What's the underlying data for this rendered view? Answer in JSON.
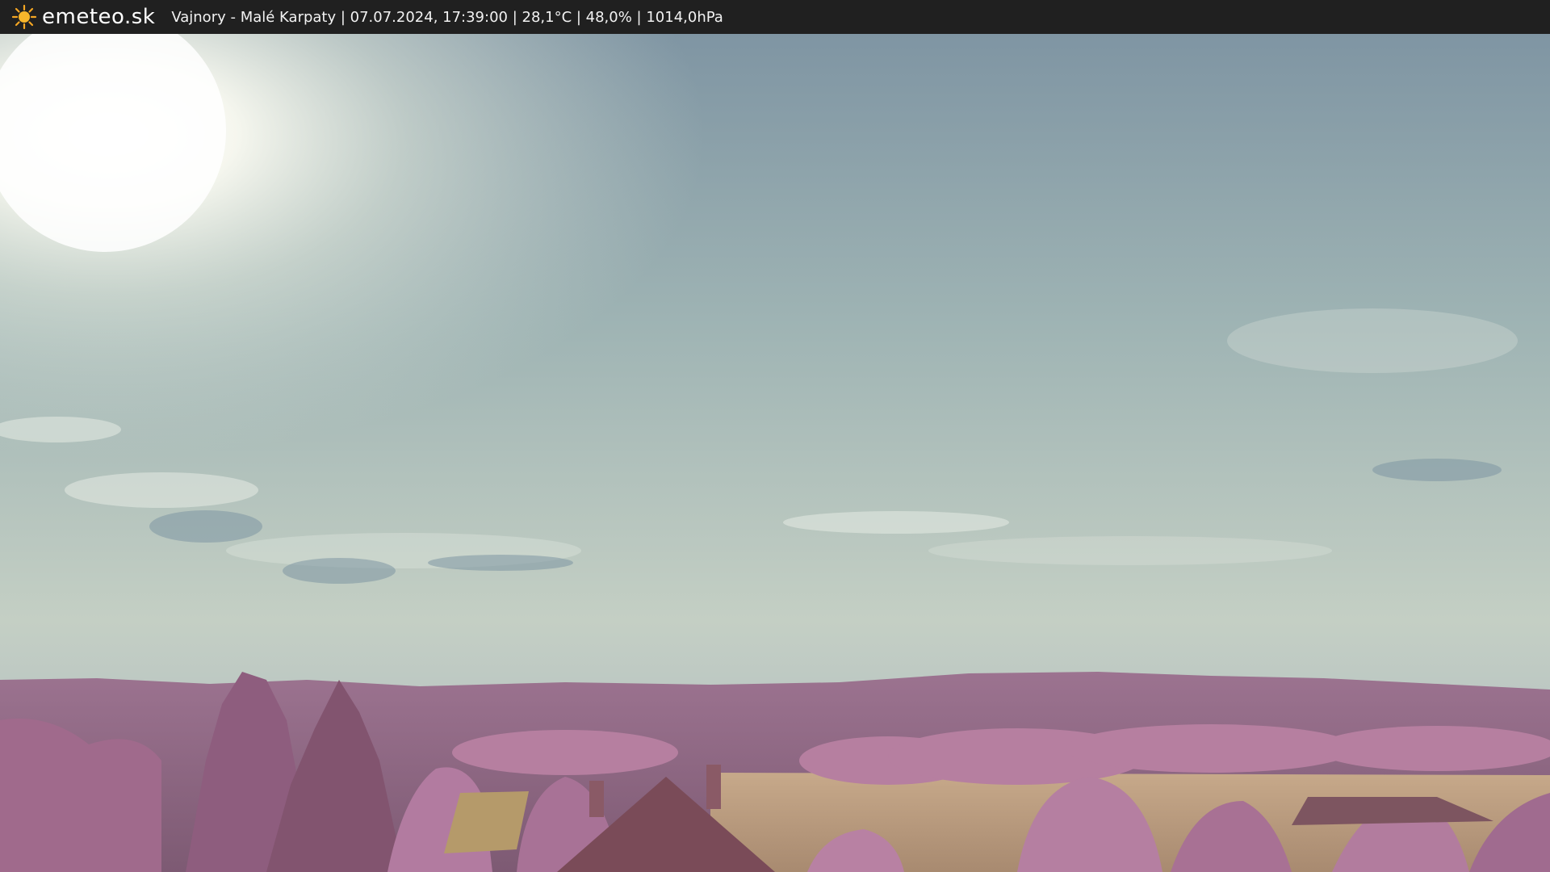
{
  "site": {
    "logo_text": "emeteo.sk",
    "logo_icon": "sun-icon"
  },
  "caption": {
    "text": "Vajnory - Malé Karpaty | 07.07.2024, 17:39:00 | 28,1°C | 48,0% | 1014,0hPa"
  },
  "colors": {
    "bar_background": "#202020",
    "sun_icon": "#f5a623",
    "sky_top": "#8fa3b0",
    "sky_bottom": "#c9d2c8",
    "foliage": "#b47a9c"
  }
}
